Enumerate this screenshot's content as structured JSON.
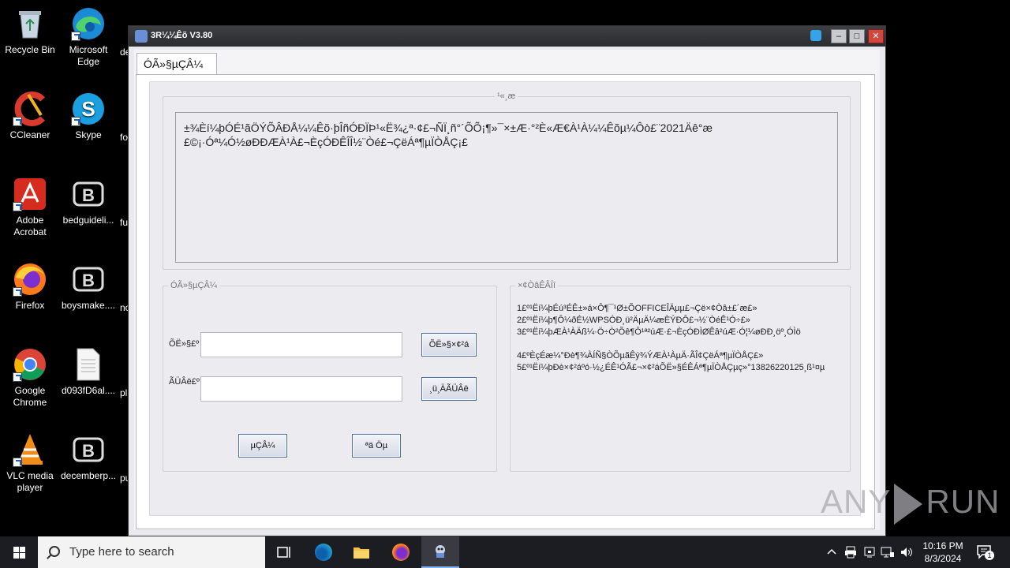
{
  "desktop": {
    "icons": [
      {
        "label": "Recycle Bin",
        "icon": "recycle-bin-icon"
      },
      {
        "label": "Microsoft Edge",
        "icon": "edge-icon"
      },
      {
        "label": "CCleaner",
        "icon": "ccleaner-icon"
      },
      {
        "label": "Skype",
        "icon": "skype-icon"
      },
      {
        "label": "Adobe Acrobat",
        "icon": "acrobat-icon"
      },
      {
        "label": "bedguideli...",
        "icon": "app-b-icon"
      },
      {
        "label": "Firefox",
        "icon": "firefox-icon"
      },
      {
        "label": "boysmake....",
        "icon": "app-b-icon"
      },
      {
        "label": "Google Chrome",
        "icon": "chrome-icon"
      },
      {
        "label": "d093fD6al....",
        "icon": "document-icon"
      },
      {
        "label": "VLC media player",
        "icon": "vlc-icon"
      },
      {
        "label": "decemberp...",
        "icon": "app-b-icon"
      }
    ],
    "partial_labels": [
      "de",
      "fo",
      "fu",
      "no",
      "pl",
      "pu"
    ]
  },
  "window": {
    "title": "3R¼¼Êõ V3.80",
    "tab_label": "ÓÃ»§µÇÂ¼",
    "info_legend": "¹«¸æ",
    "info_text": "±¾Èí¼þÓÉ¹ãÖÝÕÂÐÅ¼¼Êõ·þÎñÓÐÏÞ¹«Ë¾¿ª·¢£¬ÑÏ¸ñ°´ÕÕ¡¶»¯×±Æ·°²È«Æ€À¹À¼¼Êõµ¼Ôò£¨2021Äê°æ\n£©¡·Óª¼Ó½øÐÐÆÀ¹À£¬ÈçÓÐÊÎÎ½¨Òé£¬ÇëÁª¶µÏÒÅÇ¡£",
    "login_legend": "ÓÃ»§µÇÂ¼",
    "username_label": "ÕË»§£º",
    "username_value": "",
    "password_label": "ÃÜÂë£º",
    "password_value": "",
    "change_account_button": "ÕË»§×¢²á",
    "change_password_button": "¸ü¸ÄÃÜÂë",
    "login_button": "µÇÂ¼",
    "exit_button": "ªä Öµ",
    "notes_legend": "×¢ÒâÊÂÏî",
    "notes": [
      "1£º¹Ëí¼þÉú³ÉÊ±»á×Ô¶¯¹Ø±ÕOFFICEÎÄµµ£¬Çë×¢Òâ±£´æ£»",
      "2£º¹Ëí¼þ¶Ô¼ðÉ½WPSÓÐ¸ü²ÄµÄ¼æÈÝÐÔ£¬½¨ÒéÊ¹Ó÷£»",
      "3£º¹Ëí¼þÆÀ¹ÀÄß¼·Ö÷Ò²Õê¶Ô¹ª²úÆ·£¬ÈçÓÐÌØÊâ²úÆ·Ó¦¼øÐÐ¸öº¸ÓÌö",
      "",
      "4£ºÈçÉæ¼°Ðè¶¾ÀÍÑ§ÒÕµãÊý¾ÝÆÀ¹ÀµÄ·ÃÎ¢ÇëÁª¶µÏÒÅÇ£»",
      "5£º¹Ëí¼þÐè×¢²áºó·½¿ÉÊ¹ÓÃ£¬×¢²áÕË»§ÉÊÁª¶µÏÒÅÇµç»°13826220125¸ß¹¤µ"
    ]
  },
  "watermark": {
    "text_left": "ANY",
    "text_right": "RUN"
  },
  "taskbar": {
    "search_placeholder": "Type here to search",
    "time": "10:16 PM",
    "date": "8/3/2024",
    "notification_count": "1"
  }
}
